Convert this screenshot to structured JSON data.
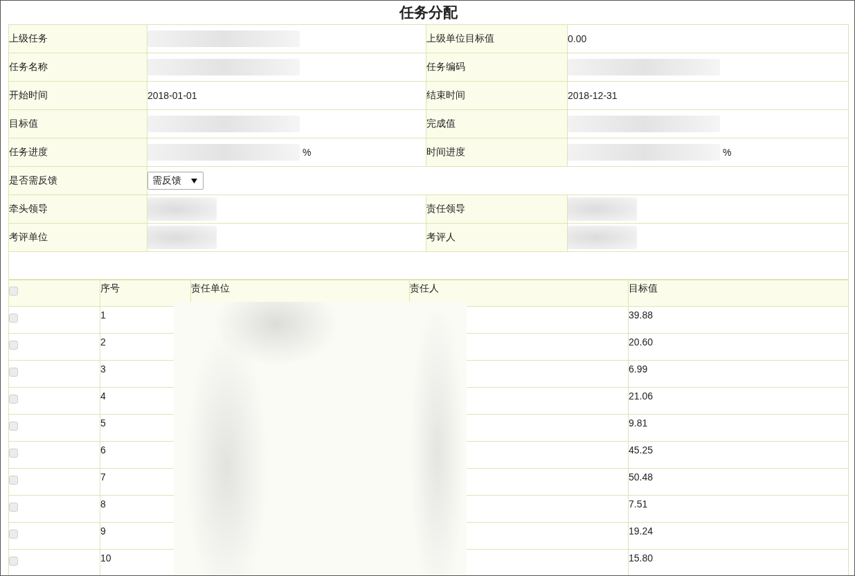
{
  "title": "任务分配",
  "form": {
    "rows": [
      {
        "kind": "pair",
        "fields": [
          {
            "label": "上级任务",
            "redacted": true
          },
          {
            "label": "上级单位目标值",
            "value": "0.00",
            "redacted": false
          }
        ]
      },
      {
        "kind": "pair",
        "fields": [
          {
            "label": "任务名称",
            "redacted": true
          },
          {
            "label": "任务编码",
            "redacted": true
          }
        ]
      },
      {
        "kind": "pair",
        "fields": [
          {
            "label": "开始时间",
            "value": "2018-01-01",
            "redacted": false
          },
          {
            "label": "结束时间",
            "value": "2018-12-31",
            "redacted": false
          }
        ]
      },
      {
        "kind": "pair",
        "fields": [
          {
            "label": "目标值",
            "redacted": true
          },
          {
            "label": "完成值",
            "redacted": true
          }
        ]
      },
      {
        "kind": "pair",
        "fields": [
          {
            "label": "任务进度",
            "redacted": true,
            "suffix": "%"
          },
          {
            "label": "时间进度",
            "redacted": true,
            "suffix": "%"
          }
        ]
      },
      {
        "kind": "select",
        "label": "是否需反馈",
        "value": "需反馈"
      },
      {
        "kind": "pair",
        "fields": [
          {
            "label": "牵头领导",
            "redacted": true
          },
          {
            "label": "责任领导",
            "redacted": true
          }
        ]
      },
      {
        "kind": "pair",
        "fields": [
          {
            "label": "考评单位",
            "redacted": true
          },
          {
            "label": "考评人",
            "redacted": true
          }
        ]
      },
      {
        "kind": "blank"
      }
    ]
  },
  "assignments": {
    "select_all": {
      "checked": false
    },
    "columns": [
      "序号",
      "责任单位",
      "责任人",
      "目标值"
    ],
    "rows": [
      {
        "checked": false,
        "index": "1",
        "target": "39.88"
      },
      {
        "checked": false,
        "index": "2",
        "target": "20.60"
      },
      {
        "checked": false,
        "index": "3",
        "target": "6.99"
      },
      {
        "checked": false,
        "index": "4",
        "target": "21.06"
      },
      {
        "checked": false,
        "index": "5",
        "target": "9.81"
      },
      {
        "checked": false,
        "index": "6",
        "target": "45.25"
      },
      {
        "checked": false,
        "index": "7",
        "target": "50.48"
      },
      {
        "checked": false,
        "index": "8",
        "target": "7.51"
      },
      {
        "checked": false,
        "index": "9",
        "target": "19.24"
      },
      {
        "checked": false,
        "index": "10",
        "target": "15.80"
      }
    ]
  }
}
